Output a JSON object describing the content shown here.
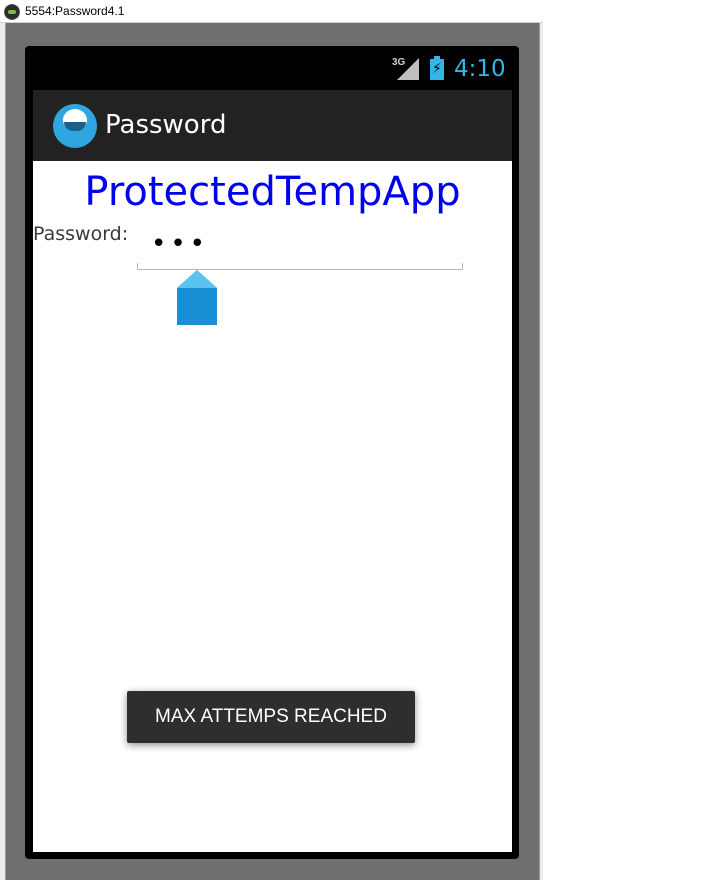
{
  "window": {
    "title": "5554:Password4.1"
  },
  "statusbar": {
    "network": "3G",
    "time": "4:10",
    "icons": [
      "signal-icon",
      "battery-charging-icon"
    ]
  },
  "actionbar": {
    "title": "Password",
    "icon": "app-logo-icon"
  },
  "main": {
    "heading": "ProtectedTempApp",
    "password_label": "Password:",
    "password_value": "•••"
  },
  "toast": {
    "message": "MAX ATTEMPS REACHED"
  },
  "colors": {
    "accent": "#33b5e5",
    "heading": "#0000ee",
    "actionbar": "#222222",
    "toast": "#2e2e2e"
  }
}
